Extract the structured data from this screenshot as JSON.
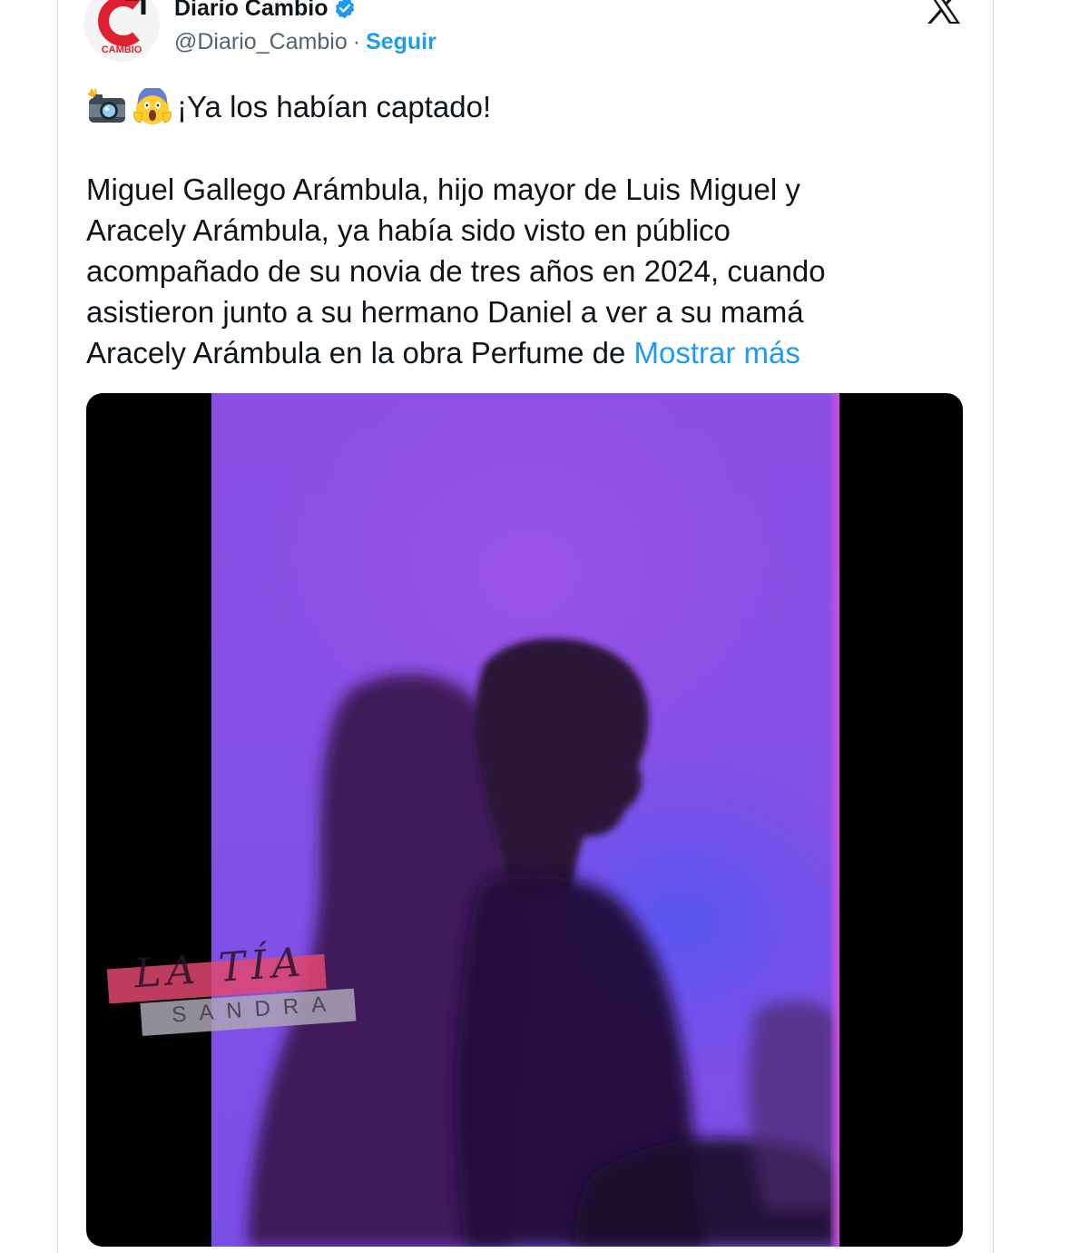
{
  "tweet": {
    "author": {
      "display_name": "Diario Cambio",
      "handle": "@Diario_Cambio",
      "separator": "·",
      "follow_label": "Seguir",
      "avatar_text": "CAMBIO",
      "avatar_icon": "cambio-logo"
    },
    "platform_icon": "x-logo-icon",
    "headline": {
      "emojis": [
        "camera-with-flash-emoji",
        "screaming-face-emoji"
      ],
      "text": "¡Ya los habían captado!"
    },
    "body_lines": [
      "Miguel Gallego Arámbula, hijo mayor de Luis Miguel y",
      "Aracely Arámbula, ya había sido visto en público",
      "acompañado de su novia de tres años en 2024, cuando",
      "asistieron junto a su hermano Daniel a ver a su mamá",
      "Aracely Arámbula en la obra Perfume de "
    ],
    "show_more_label": "Mostrar más",
    "media": {
      "type": "video",
      "watermark": {
        "script_text": "LA TÍA",
        "text": "SANDRA"
      }
    }
  },
  "colors": {
    "link": "#1d9bf0",
    "text": "#0f1419",
    "secondary": "#536471",
    "border": "#cfd9de",
    "brand_red": "#e0202e"
  }
}
